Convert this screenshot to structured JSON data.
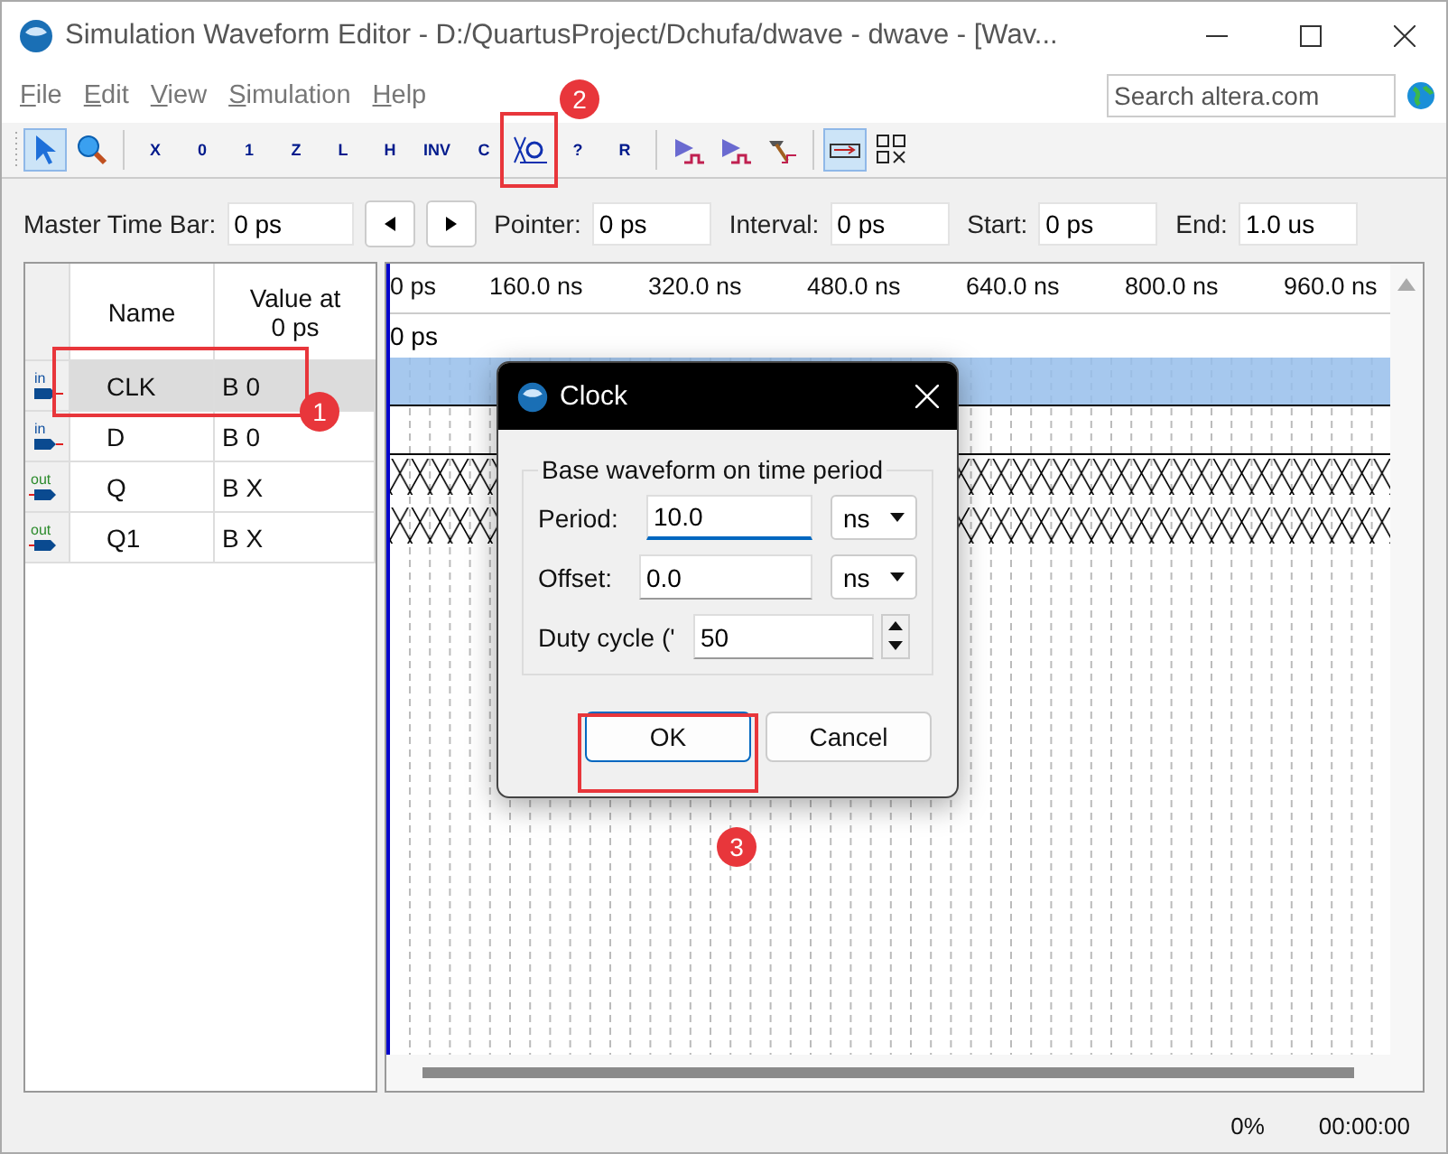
{
  "window": {
    "title": "Simulation Waveform Editor - D:/QuartusProject/Dchufa/dwave - dwave - [Wav..."
  },
  "menu": [
    "File",
    "Edit",
    "View",
    "Simulation",
    "Help"
  ],
  "search": {
    "placeholder": "Search altera.com"
  },
  "toolbar": [
    {
      "kind": "pointer",
      "selected": true
    },
    {
      "kind": "zoom",
      "selected": false
    },
    {
      "kind": "sep"
    },
    {
      "kind": "value",
      "label": "X",
      "selected": false
    },
    {
      "kind": "value",
      "label": "0",
      "selected": false
    },
    {
      "kind": "value",
      "label": "1",
      "selected": false
    },
    {
      "kind": "value",
      "label": "Z",
      "selected": false
    },
    {
      "kind": "value",
      "label": "L",
      "selected": false
    },
    {
      "kind": "value",
      "label": "H",
      "selected": false
    },
    {
      "kind": "value",
      "label": "INV",
      "selected": false
    },
    {
      "kind": "value",
      "label": "C",
      "selected": false
    },
    {
      "kind": "clock",
      "selected": false,
      "annotation": "2"
    },
    {
      "kind": "value",
      "label": "?",
      "selected": false
    },
    {
      "kind": "value",
      "label": "R",
      "selected": false
    },
    {
      "kind": "sep"
    },
    {
      "kind": "run",
      "selected": false
    },
    {
      "kind": "run",
      "selected": false
    },
    {
      "kind": "hammer",
      "selected": false
    },
    {
      "kind": "sep"
    },
    {
      "kind": "snap",
      "selected": true
    },
    {
      "kind": "grid",
      "selected": false
    }
  ],
  "time_bar": {
    "master": {
      "label": "Master Time Bar:",
      "value": "0 ps"
    },
    "fields": [
      {
        "label": "Pointer:",
        "value": "0 ps"
      },
      {
        "label": "Interval:",
        "value": "0 ps"
      },
      {
        "label": "Start:",
        "value": "0 ps"
      },
      {
        "label": "End:",
        "value": "1.0 us"
      }
    ]
  },
  "table": {
    "columns": [
      "Name",
      "Value at 0 ps"
    ]
  },
  "signals": [
    {
      "direction": "in",
      "name": "CLK",
      "value": "B 0",
      "selected": true,
      "kind": "low",
      "annotation": "1"
    },
    {
      "direction": "in",
      "name": "D",
      "value": "B 0",
      "selected": false,
      "kind": "low"
    },
    {
      "direction": "out",
      "name": "Q",
      "value": "B X",
      "selected": false,
      "kind": "unknown"
    },
    {
      "direction": "out",
      "name": "Q1",
      "value": "B X",
      "selected": false,
      "kind": "unknown"
    }
  ],
  "ruler": {
    "ticks": [
      "0 ps",
      "160.0 ns",
      "320.0 ns",
      "480.0 ns",
      "640.0 ns",
      "800.0 ns",
      "960.0 ns"
    ],
    "cursor": "0 ps"
  },
  "dialog": {
    "title": "Clock",
    "group": "Base waveform on time period",
    "fields": [
      {
        "kind": "unit",
        "label": "Period:",
        "value": "10.0",
        "unit": "ns",
        "focused": true
      },
      {
        "kind": "unit",
        "label": "Offset:",
        "value": "0.0",
        "unit": "ns",
        "focused": false
      },
      {
        "kind": "spin",
        "label": "Duty cycle ('",
        "value": "50",
        "focused": false
      }
    ],
    "buttons": [
      {
        "label": "OK",
        "default": true,
        "annotation": "3"
      },
      {
        "label": "Cancel",
        "default": false
      }
    ]
  },
  "status": [
    "0%",
    "00:00:00"
  ]
}
